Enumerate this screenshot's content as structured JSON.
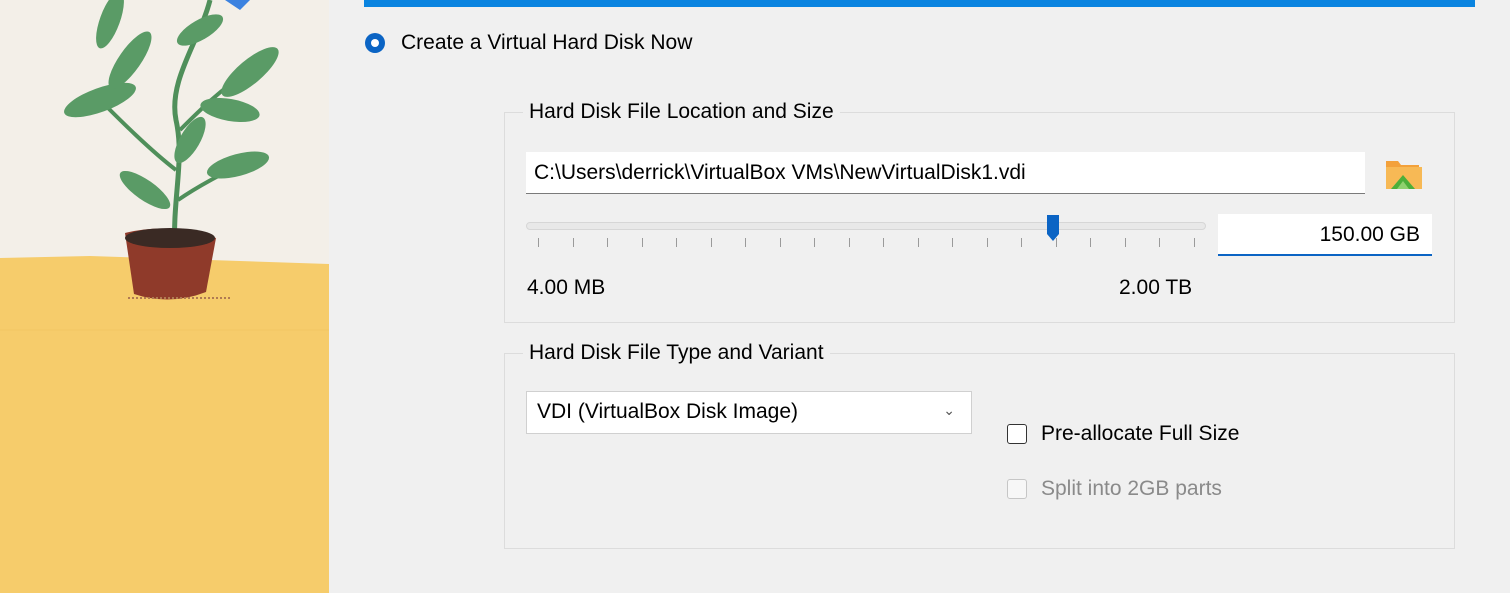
{
  "create_option": {
    "label": "Create a Virtual Hard Disk Now",
    "selected": true
  },
  "location_group": {
    "title": "Hard Disk File Location and Size",
    "path_value": "C:\\Users\\derrick\\VirtualBox VMs\\NewVirtualDisk1.vdi",
    "folder_icon": "folder-browse-icon",
    "size": {
      "value_text": "150.00 GB",
      "min_label": "4.00 MB",
      "max_label": "2.00 TB",
      "slider_fraction": 0.785
    }
  },
  "type_group": {
    "title": "Hard Disk File Type and Variant",
    "format_selected": "VDI (VirtualBox Disk Image)",
    "preallocate": {
      "label": "Pre-allocate Full Size",
      "checked": false,
      "enabled": true
    },
    "split": {
      "label": "Split into 2GB parts",
      "checked": false,
      "enabled": false
    }
  },
  "colors": {
    "accent": "#0b64c4",
    "header_bar": "#0a84e0",
    "illustration_floor": "#f6cc6b"
  }
}
